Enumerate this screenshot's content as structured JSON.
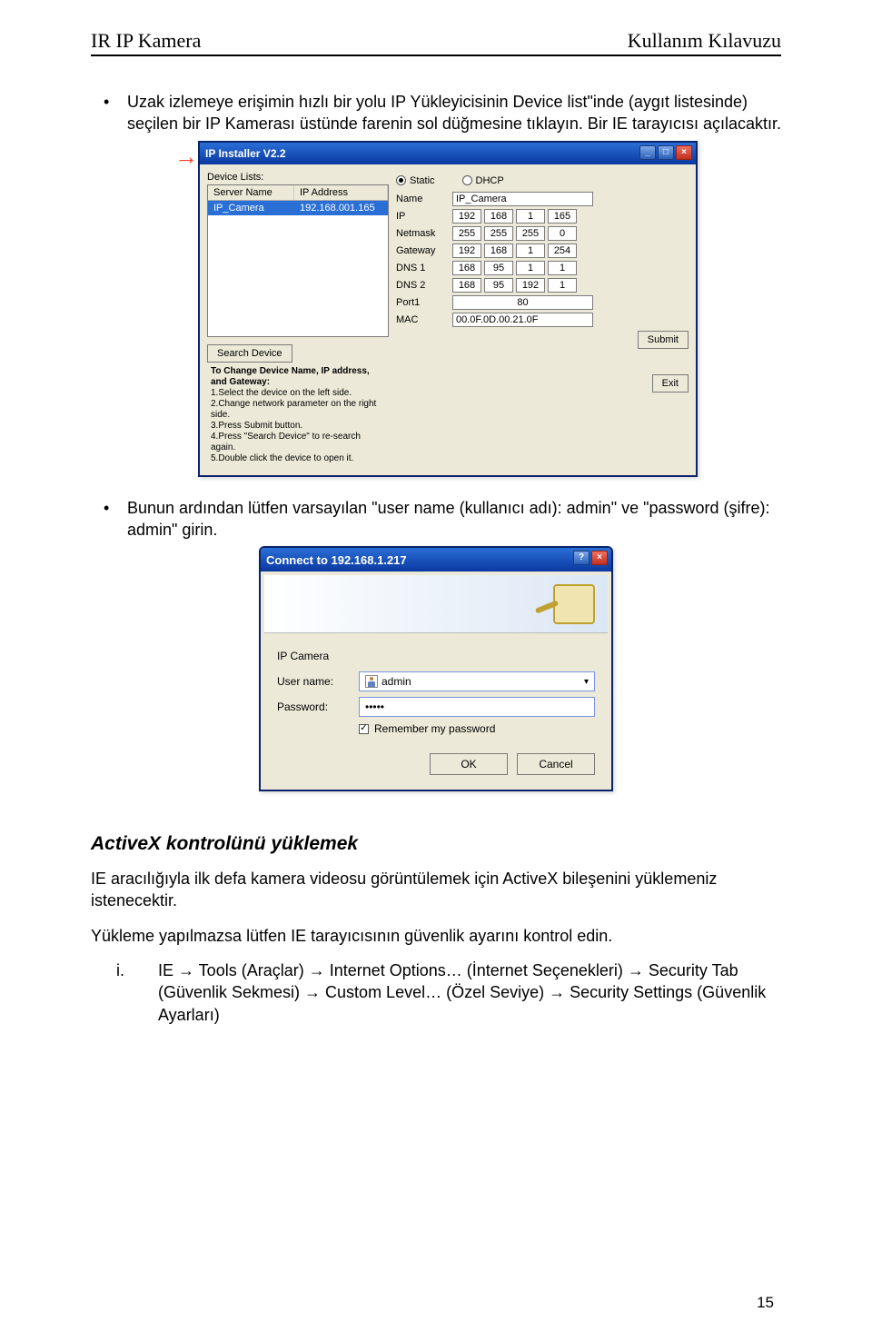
{
  "header": {
    "left": "IR IP Kamera",
    "right": "Kullanım Kılavuzu"
  },
  "bullet1": "Uzak izlemeye erişimin hızlı bir yolu IP Yükleyicisinin Device list\"inde (aygıt listesinde) seçilen bir IP Kamerası üstünde farenin sol düğmesine tıklayın. Bir IE tarayıcısı açılacaktır.",
  "bullet2": "Bunun ardından lütfen varsayılan \"user name (kullanıcı adı): admin\" ve \"password (şifre): admin\" girin.",
  "installer": {
    "title": "IP Installer V2.2",
    "device_lists_label": "Device Lists:",
    "columns": {
      "srv": "Server Name",
      "ip": "IP Address"
    },
    "row": {
      "srv": "IP_Camera",
      "ip": "192.168.001.165"
    },
    "mode": {
      "static": "Static",
      "dhcp": "DHCP"
    },
    "fields": {
      "name": "Name",
      "name_val": "IP_Camera",
      "ip": "IP",
      "ip_val": [
        "192",
        "168",
        "1",
        "165"
      ],
      "netmask": "Netmask",
      "netmask_val": [
        "255",
        "255",
        "255",
        "0"
      ],
      "gateway": "Gateway",
      "gateway_val": [
        "192",
        "168",
        "1",
        "254"
      ],
      "dns1": "DNS 1",
      "dns1_val": [
        "168",
        "95",
        "1",
        "1"
      ],
      "dns2": "DNS 2",
      "dns2_val": [
        "168",
        "95",
        "192",
        "1"
      ],
      "port1": "Port1",
      "port1_val": "80",
      "mac": "MAC",
      "mac_val": "00.0F.0D.00.21.0F"
    },
    "search_btn": "Search Device",
    "submit_btn": "Submit",
    "exit_btn": "Exit",
    "instructions_title": "To Change Device Name, IP address, and Gateway:",
    "instructions": [
      "1.Select the device on the left side.",
      "2.Change network parameter on the right side.",
      "3.Press Submit button.",
      "4.Press \"Search Device\" to re-search again.",
      "5.Double click the device to open it."
    ]
  },
  "dialog": {
    "title": "Connect to 192.168.1.217",
    "site": "IP Camera",
    "user_label": "User name:",
    "user_val": "admin",
    "pass_label": "Password:",
    "pass_val": "•••••",
    "remember": "Remember my password",
    "ok": "OK",
    "cancel": "Cancel"
  },
  "section_title": "ActiveX kontrolünü yüklemek",
  "para1": "IE aracılığıyla ilk defa kamera videosu görüntülemek için ActiveX bileşenini yüklemeniz istenecektir.",
  "para2": "Yükleme yapılmazsa lütfen IE tarayıcısının güvenlik ayarını kontrol edin.",
  "sublist_marker": "i.",
  "sublist_text": "IE → Tools (Araçlar) → Internet Options… (İnternet Seçenekleri) → Security Tab (Güvenlik Sekmesi) → Custom Level… (Özel Seviye) → Security Settings (Güvenlik Ayarları)",
  "page_number": "15"
}
